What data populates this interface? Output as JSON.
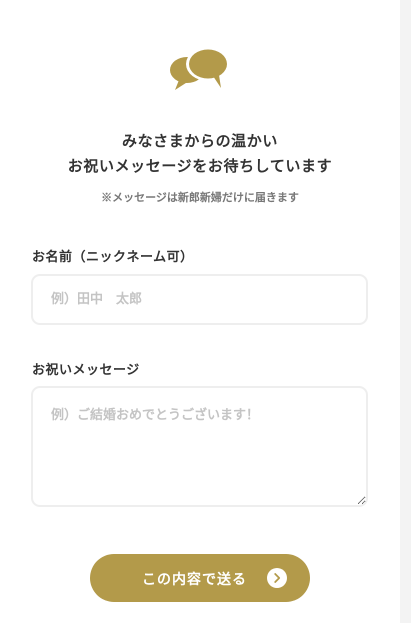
{
  "header": {
    "icon": "speech-bubbles-icon",
    "line1": "みなさまからの温かい",
    "line2": "お祝いメッセージをお待ちしています",
    "note": "※メッセージは新郎新婦だけに届きます"
  },
  "form": {
    "name_label": "お名前（ニックネーム可）",
    "name_placeholder": "例）田中　太郎",
    "message_label": "お祝いメッセージ",
    "message_placeholder": "例）ご結婚おめでとうございます！",
    "submit_label": "この内容で送る",
    "submit_icon": "chevron-right-circle-icon"
  },
  "colors": {
    "accent": "#b39a4a",
    "text": "#333333",
    "field_border": "#eeeeee",
    "placeholder": "#c4c4c4"
  }
}
